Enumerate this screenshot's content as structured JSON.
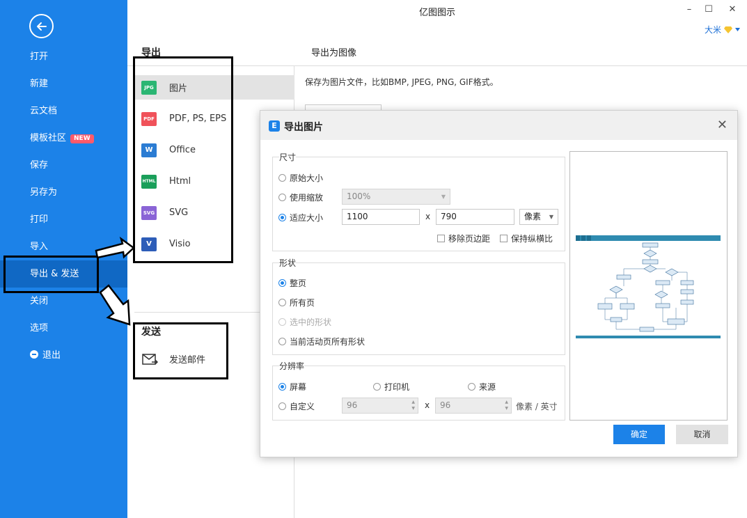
{
  "window": {
    "title": "亿图图示",
    "user_name": "大米",
    "minimize": "–",
    "maximize": "☐",
    "close": "✕"
  },
  "sidebar": {
    "back": "back-arrow",
    "items": [
      {
        "label": "打开"
      },
      {
        "label": "新建"
      },
      {
        "label": "云文档"
      },
      {
        "label": "模板社区",
        "badge": "NEW"
      },
      {
        "label": "保存"
      },
      {
        "label": "另存为"
      },
      {
        "label": "打印"
      },
      {
        "label": "导入"
      },
      {
        "label": "导出 & 发送"
      },
      {
        "label": "关闭"
      },
      {
        "label": "选项"
      },
      {
        "label": "退出"
      }
    ]
  },
  "export_section": {
    "title": "导出",
    "items": [
      {
        "label": "图片",
        "icon": "JPG",
        "color": "#2bb673"
      },
      {
        "label": "PDF, PS, EPS",
        "icon": "PDF",
        "color": "#f0525a"
      },
      {
        "label": "Office",
        "icon": "W",
        "color": "#2b7cd3"
      },
      {
        "label": "Html",
        "icon": "HTML",
        "color": "#1a9f5a"
      },
      {
        "label": "SVG",
        "icon": "SVG",
        "color": "#8a64d6"
      },
      {
        "label": "Visio",
        "icon": "V",
        "color": "#2d5db8"
      }
    ]
  },
  "send_section": {
    "title": "发送",
    "items": [
      {
        "label": "发送邮件"
      }
    ]
  },
  "panel": {
    "title": "导出为图像",
    "description": "保存为图片文件，比如BMP, JPEG, PNG, GIF格式。"
  },
  "dialog": {
    "title": "导出图片",
    "size_group": {
      "title": "尺寸",
      "original": "原始大小",
      "use_zoom": "使用缩放",
      "zoom_value": "100%",
      "fit_size": "适应大小",
      "width": "1100",
      "height": "790",
      "unit": "像素",
      "x": "x",
      "remove_margin": "移除页边距",
      "keep_ratio": "保持纵横比"
    },
    "shape_group": {
      "title": "形状",
      "whole_page": "整页",
      "all_pages": "所有页",
      "selected_shapes": "选中的形状",
      "active_page_shapes": "当前活动页所有形状"
    },
    "resolution_group": {
      "title": "分辨率",
      "screen": "屏幕",
      "printer": "打印机",
      "source": "来源",
      "custom": "自定义",
      "dpi_x": "96",
      "dpi_y": "96",
      "x": "x",
      "unit": "像素 / 英寸"
    },
    "ok": "确定",
    "cancel": "取消"
  }
}
